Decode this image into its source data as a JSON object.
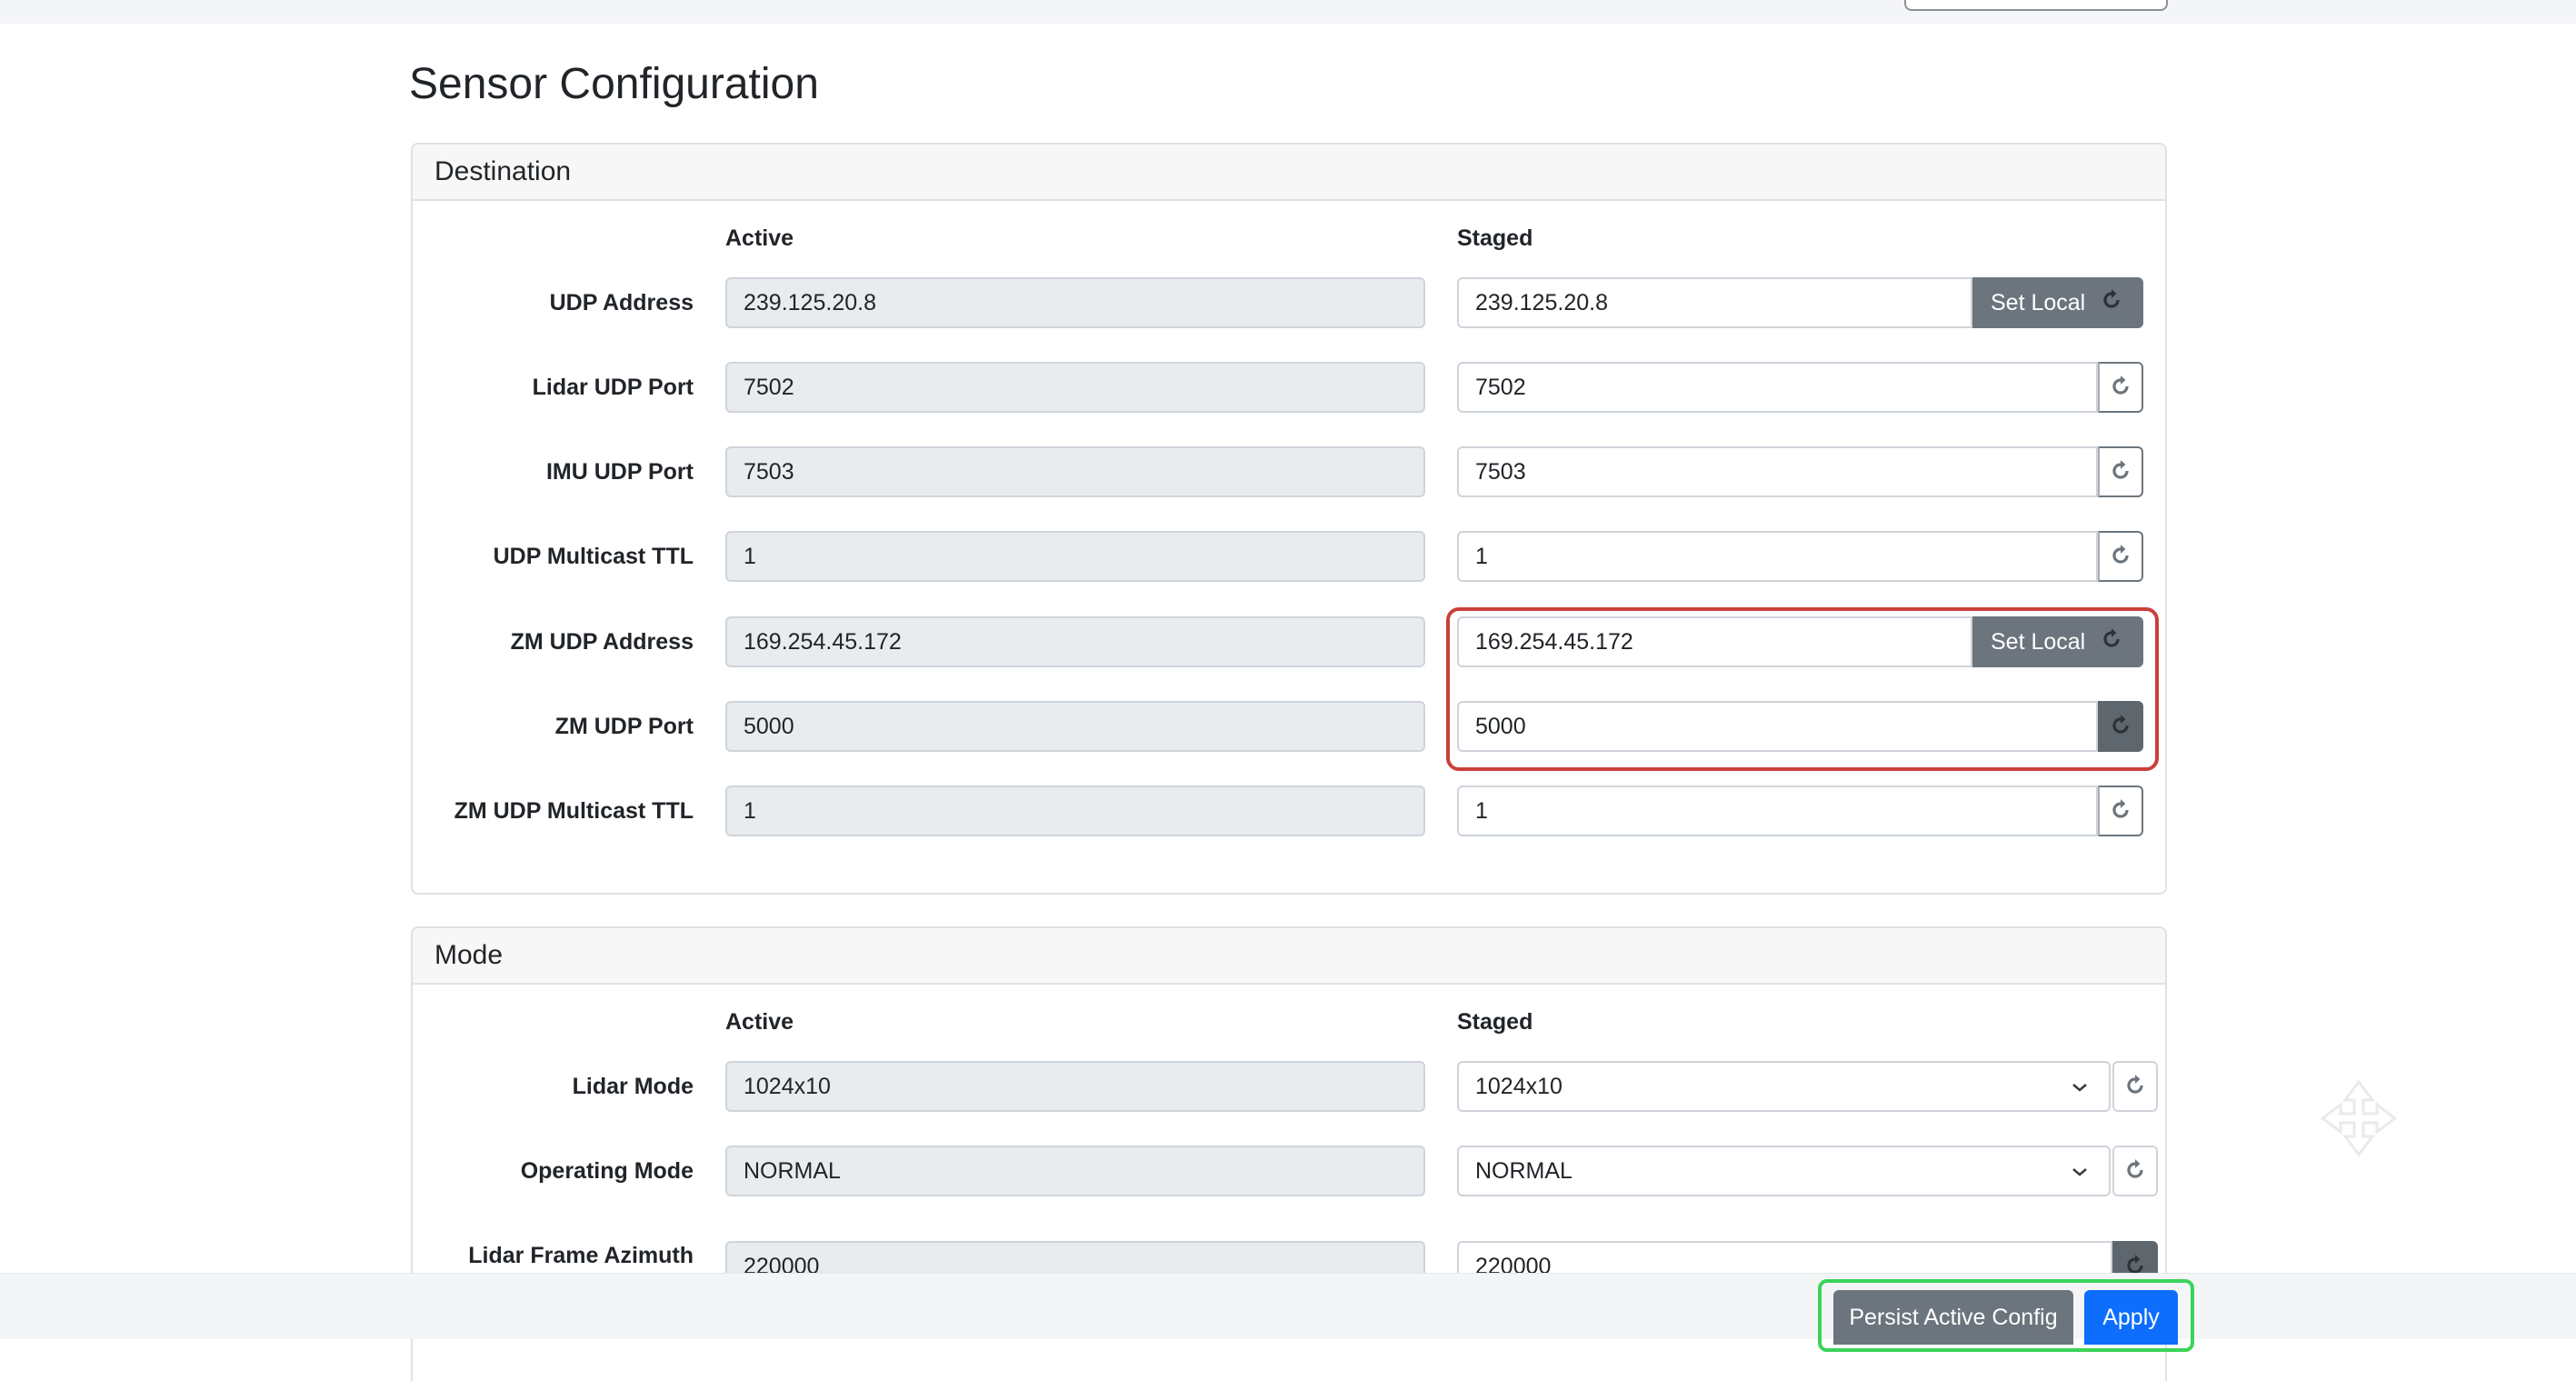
{
  "page_title": "Sensor Configuration",
  "colors": {
    "secondary": "#6c757d",
    "primary": "#0d6efd",
    "highlight_red": "#c9403b",
    "highlight_green": "#3bd45a"
  },
  "destination": {
    "header": "Destination",
    "active_label": "Active",
    "staged_label": "Staged",
    "rows": [
      {
        "label": "UDP Address",
        "active": "239.125.20.8",
        "staged": "239.125.20.8",
        "button": "Set Local"
      },
      {
        "label": "Lidar UDP Port",
        "active": "7502",
        "staged": "7502"
      },
      {
        "label": "IMU UDP Port",
        "active": "7503",
        "staged": "7503"
      },
      {
        "label": "UDP Multicast TTL",
        "active": "1",
        "staged": "1"
      },
      {
        "label": "ZM UDP Address",
        "active": "169.254.45.172",
        "staged": "169.254.45.172",
        "button": "Set Local"
      },
      {
        "label": "ZM UDP Port",
        "active": "5000",
        "staged": "5000"
      },
      {
        "label": "ZM UDP Multicast TTL",
        "active": "1",
        "staged": "1"
      }
    ]
  },
  "mode": {
    "header": "Mode",
    "active_label": "Active",
    "staged_label": "Staged",
    "rows": [
      {
        "label": "Lidar Mode",
        "active": "1024x10",
        "staged": "1024x10"
      },
      {
        "label": "Operating Mode",
        "active": "NORMAL",
        "staged": "NORMAL"
      },
      {
        "label": "Lidar Frame Azimuth",
        "active": "220000",
        "staged": "220000"
      }
    ]
  },
  "footer": {
    "persist_label": "Persist Active Config",
    "apply_label": "Apply"
  },
  "icons": {
    "reset": "reset-icon",
    "dropdown": "chevron-down-icon"
  }
}
